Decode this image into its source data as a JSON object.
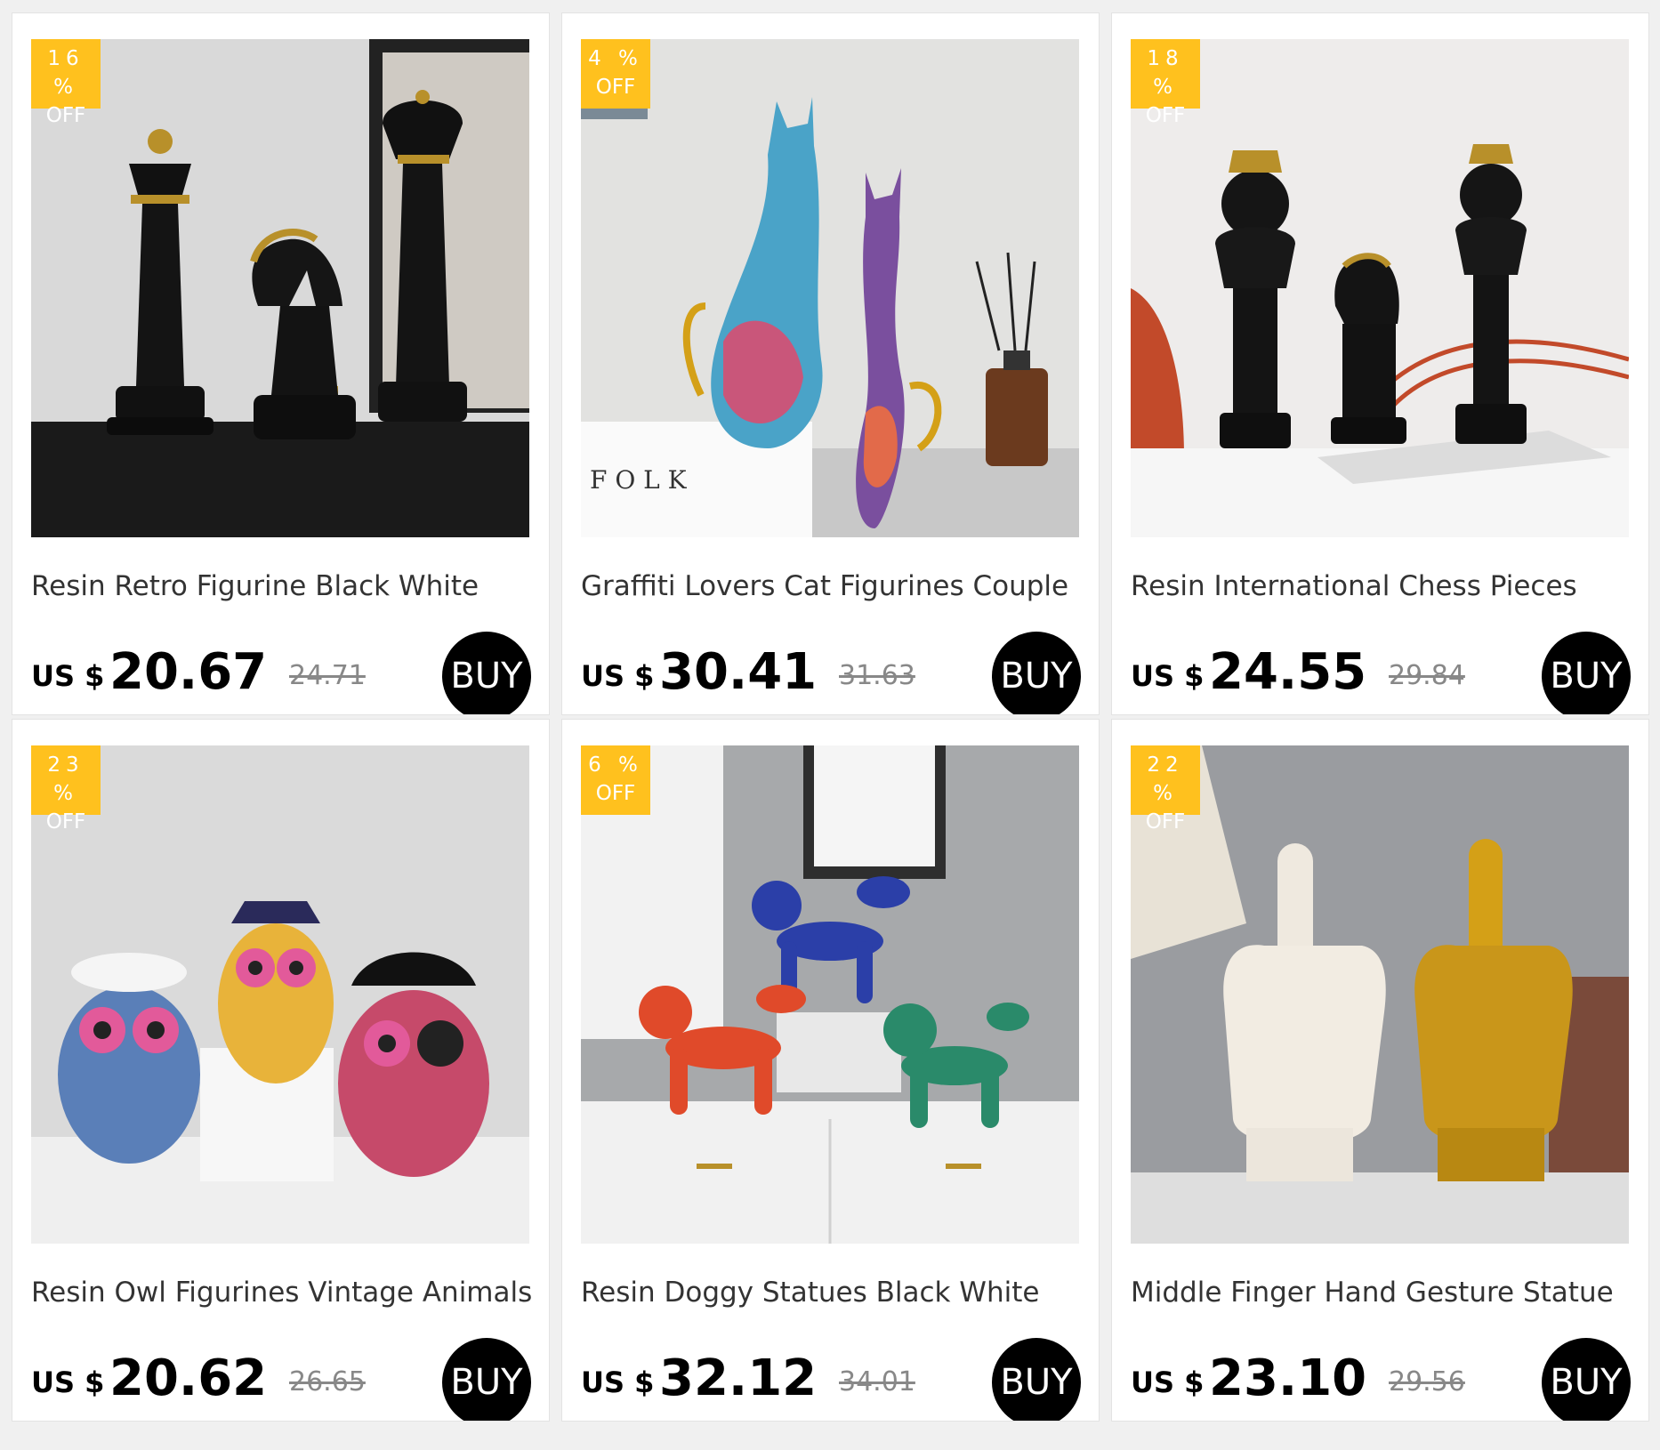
{
  "currency_label": "US $",
  "buy_label": "BUY",
  "off_label": "OFF",
  "products": [
    {
      "title": "Resin Retro Figurine Black White",
      "price": "20.67",
      "original_price": "24.71",
      "discount": "16 %",
      "image": "chess-pieces-image"
    },
    {
      "title": "Graffiti Lovers Cat Figurines Couple",
      "price": "30.41",
      "original_price": "31.63",
      "discount": "4 %",
      "image": "graffiti-cats-image"
    },
    {
      "title": "Resin International Chess Pieces",
      "price": "24.55",
      "original_price": "29.84",
      "discount": "18 %",
      "image": "chess-busts-image"
    },
    {
      "title": "Resin Owl Figurines Vintage Animals",
      "price": "20.62",
      "original_price": "26.65",
      "discount": "23 %",
      "image": "owl-figurines-image"
    },
    {
      "title": "Resin Doggy Statues Black White",
      "price": "32.12",
      "original_price": "34.01",
      "discount": "6 %",
      "image": "balloon-dogs-image"
    },
    {
      "title": "Middle Finger Hand Gesture Statue",
      "price": "23.10",
      "original_price": "29.56",
      "discount": "22 %",
      "image": "hand-gesture-image"
    }
  ],
  "colors": {
    "badge": "#ffc11e",
    "buy_button": "#000000",
    "page_bg": "#f0f0f0"
  }
}
